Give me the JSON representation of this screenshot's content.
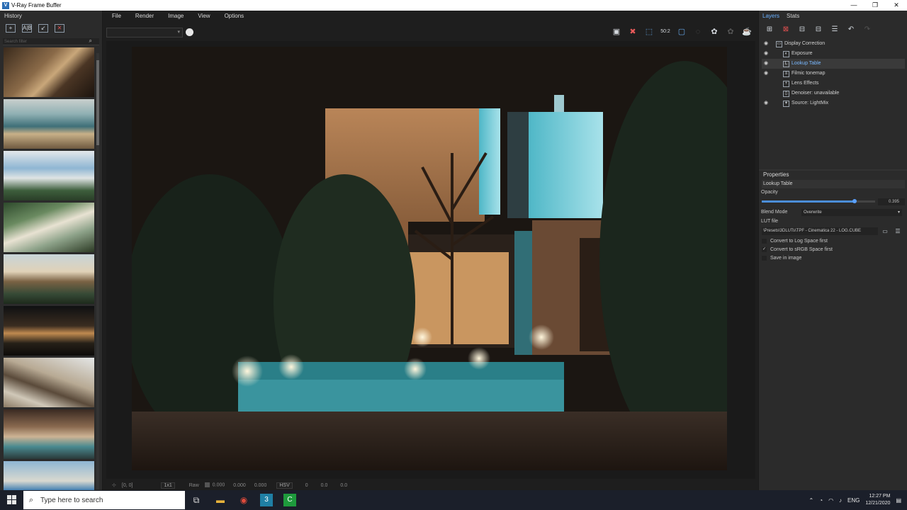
{
  "window": {
    "title": "V-Ray Frame Buffer",
    "app_icon": "V",
    "minimize": "—",
    "maximize": "❐",
    "close": "✕"
  },
  "history": {
    "title": "History",
    "search_placeholder": "Search filter",
    "tools": [
      "save-history-icon",
      "compare-ab-icon",
      "load-history-icon",
      "remove-history-icon"
    ]
  },
  "menu": [
    "File",
    "Render",
    "Image",
    "View",
    "Options"
  ],
  "toolbar": {
    "icons": [
      "save-icon",
      "clear-icon",
      "region-icon",
      "zoom-50-icon",
      "frame-icon",
      "pick-icon",
      "render-icon",
      "stop-icon",
      "teapot-icon"
    ],
    "zoom_label": "50:2"
  },
  "statusbar": {
    "coords": "[0, 0]",
    "zoom": "1x1",
    "mode": "Raw",
    "values": [
      "0.000",
      "0.000",
      "0.000"
    ],
    "colorspace": "HSV",
    "hsv": [
      "0",
      "0.0",
      "0.0"
    ]
  },
  "right": {
    "tabs": [
      "Layers",
      "Stats"
    ],
    "layers": [
      {
        "name": "Display Correction",
        "eye": true,
        "indent": 0
      },
      {
        "name": "Exposure",
        "eye": true,
        "indent": 1
      },
      {
        "name": "Lookup Table",
        "eye": true,
        "indent": 1,
        "selected": true
      },
      {
        "name": "Filmic tonemap",
        "eye": true,
        "indent": 1
      },
      {
        "name": "Lens Effects",
        "eye": false,
        "indent": 1
      },
      {
        "name": "Denoiser: unavailable",
        "eye": false,
        "indent": 1
      },
      {
        "name": "Source: LightMix",
        "eye": true,
        "indent": 1
      }
    ],
    "properties": {
      "title": "Properties",
      "header": "Lookup Table",
      "opacity_label": "Opacity",
      "opacity_value": "0.395",
      "opacity": 0.395,
      "blend_label": "Blend Mode",
      "blend_value": "Overwrite",
      "lut_label": "LUT file",
      "lut_value": "\\Presets\\3DLUTs\\TPF - Cinematica 22 - LOG.CUBE",
      "checks": [
        {
          "label": "Convert to Log Space first",
          "checked": false
        },
        {
          "label": "Convert to sRGB Space first",
          "checked": true
        },
        {
          "label": "Save in image",
          "checked": false
        }
      ]
    }
  },
  "taskbar": {
    "search_placeholder": "Type here to search",
    "lang": "ENG",
    "time": "12:27 PM",
    "date": "12/21/2020"
  }
}
